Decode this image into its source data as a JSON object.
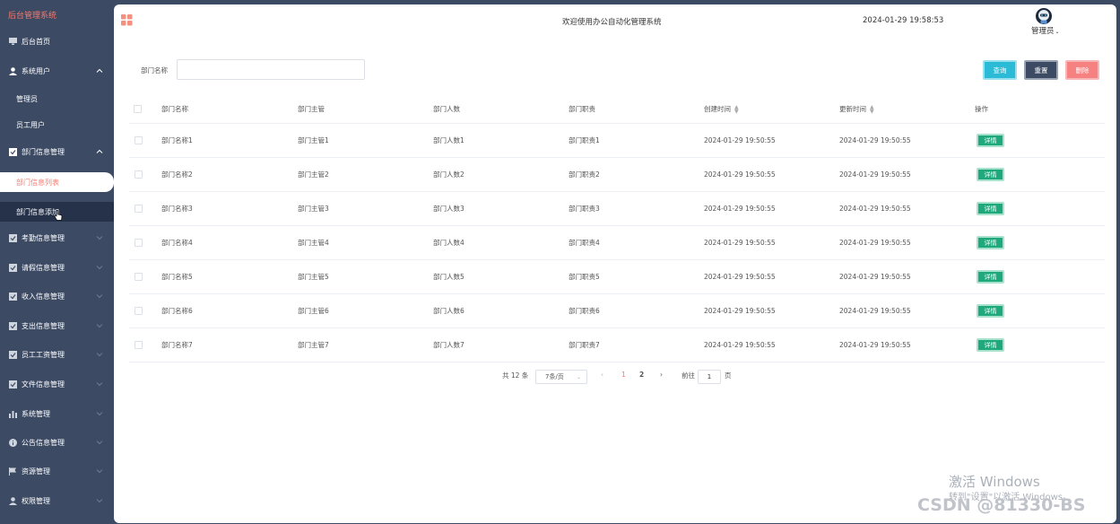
{
  "sidebar": {
    "brand": "后台管理系统",
    "home": "后台首页",
    "system_user": "系统用户",
    "admin_sub": "管理员",
    "staff_sub": "员工用户",
    "dept_mgmt": "部门信息管理",
    "dept_list": "部门信息列表",
    "dept_add": "部门信息添加",
    "attendance": "考勤信息管理",
    "leave": "请假信息管理",
    "income": "收入信息管理",
    "expense": "支出信息管理",
    "salary": "员工工资管理",
    "files": "文件信息管理",
    "sys_mgmt": "系统管理",
    "notice": "公告信息管理",
    "resource": "资源管理",
    "permission": "权限管理"
  },
  "header": {
    "welcome": "欢迎使用办公自动化管理系统",
    "datetime": "2024-01-29 19:58:53",
    "user": "管理员"
  },
  "search": {
    "label": "部门名称",
    "value": "",
    "query": "查询",
    "reset": "重置",
    "delete": "删除"
  },
  "table": {
    "headers": [
      "部门名称",
      "部门主管",
      "部门人数",
      "部门职责",
      "创建时间",
      "更新时间",
      "操作"
    ],
    "rows": [
      [
        "部门名称1",
        "部门主管1",
        "部门人数1",
        "部门职责1",
        "2024-01-29 19:50:55",
        "2024-01-29 19:50:55"
      ],
      [
        "部门名称2",
        "部门主管2",
        "部门人数2",
        "部门职责2",
        "2024-01-29 19:50:55",
        "2024-01-29 19:50:55"
      ],
      [
        "部门名称3",
        "部门主管3",
        "部门人数3",
        "部门职责3",
        "2024-01-29 19:50:55",
        "2024-01-29 19:50:55"
      ],
      [
        "部门名称4",
        "部门主管4",
        "部门人数4",
        "部门职责4",
        "2024-01-29 19:50:55",
        "2024-01-29 19:50:55"
      ],
      [
        "部门名称5",
        "部门主管5",
        "部门人数5",
        "部门职责5",
        "2024-01-29 19:50:55",
        "2024-01-29 19:50:55"
      ],
      [
        "部门名称6",
        "部门主管6",
        "部门人数6",
        "部门职责6",
        "2024-01-29 19:50:55",
        "2024-01-29 19:50:55"
      ],
      [
        "部门名称7",
        "部门主管7",
        "部门人数7",
        "部门职责7",
        "2024-01-29 19:50:55",
        "2024-01-29 19:50:55"
      ]
    ],
    "detail": "详情"
  },
  "pagination": {
    "total": "共 12 条",
    "page_size": "7条/页",
    "prev": "‹",
    "page1": "1",
    "page2": "2",
    "next": "›",
    "goto": "前往",
    "goto_value": "1",
    "page_unit": "页"
  },
  "watermark": {
    "line1": "激活 Windows",
    "line2": "转到\"设置\"以激活 Windows。",
    "csdn": "CSDN @81330-BS"
  },
  "colors": {
    "sidebar_bg": "#3c4a63",
    "accent": "#f77a6f",
    "query": "#2bbbd7",
    "delete": "#f58181",
    "detail": "#1fa87b"
  }
}
